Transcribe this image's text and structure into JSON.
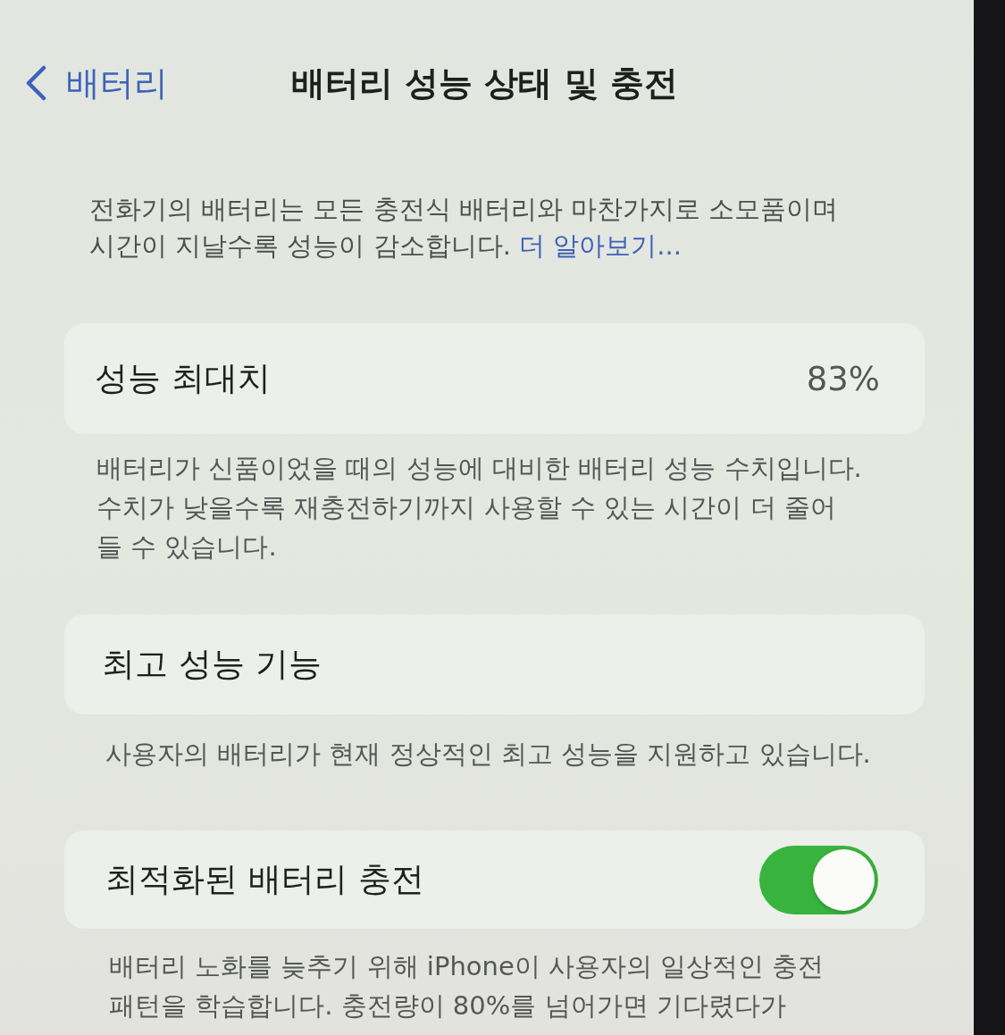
{
  "nav": {
    "back_label": "배터리",
    "title": "배터리 성능 상태 및 충전"
  },
  "intro": {
    "text": "전화기의 배터리는 모든 충전식 배터리와 마찬가지로 소모품이며\n시간이 지날수록 성능이 감소합니다.",
    "link": "더 알아보기..."
  },
  "sections": [
    {
      "kind": "value",
      "label": "성능 최대치",
      "value": "83%",
      "footer": "배터리가 신품이었을 때의 성능에 대비한 배터리 성능 수치입니다.\n수치가 낮을수록 재충전하기까지 사용할 수 있는 시간이 더 줄어\n들 수 있습니다."
    },
    {
      "kind": "plain",
      "label": "최고 성능 기능",
      "footer": "사용자의 배터리가 현재 정상적인 최고 성능을 지원하고 있습니다."
    },
    {
      "kind": "toggle",
      "label": "최적화된 배터리 충전",
      "on": true,
      "footer": "배터리 노화를 늦추기 위해 iPhone이 사용자의 일상적인 충전\n패턴을 학습합니다. 충전량이 80%를 넘어가면 기다렸다가"
    }
  ]
}
